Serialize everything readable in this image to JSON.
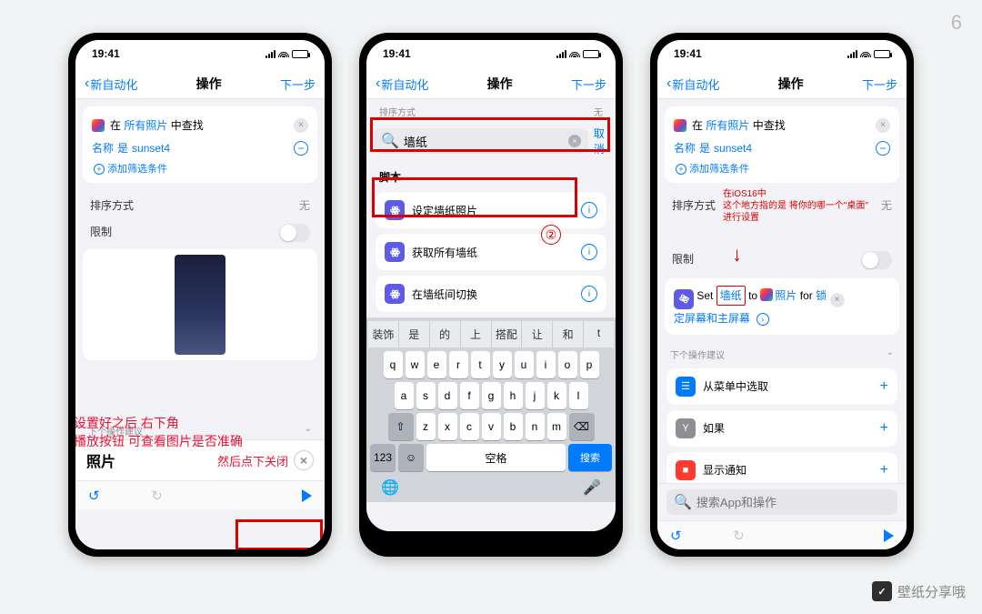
{
  "page_number": "6",
  "statusbar": {
    "time": "19:41"
  },
  "nav": {
    "back": "新自动化",
    "title": "操作",
    "next": "下一步"
  },
  "p1": {
    "find_prefix": "在",
    "find_scope": "所有照片",
    "find_suffix": "中查找",
    "name_label": "名称",
    "is_label": "是",
    "name_value": "sunset4",
    "add_filter": "添加筛选条件",
    "sort_label": "排序方式",
    "sort_value": "无",
    "limit_label": "限制",
    "suggest_label": "下个操作建议",
    "photos_label": "照片",
    "anno1": "设置好之后 右下角\n播放按钮 可查看图片是否准确",
    "anno2": "然后点下关闭"
  },
  "p2": {
    "sort_label": "排序方式",
    "sort_value": "无",
    "search_value": "墙纸",
    "cancel": "取消",
    "section": "脚本",
    "item1": "设定墙纸照片",
    "item2": "获取所有墙纸",
    "item3": "在墙纸间切换",
    "pred": [
      "装饰",
      "是",
      "的",
      "上",
      "搭配",
      "让",
      "和",
      "t"
    ],
    "keys_r1": [
      "q",
      "w",
      "e",
      "r",
      "t",
      "y",
      "u",
      "i",
      "o",
      "p"
    ],
    "keys_r2": [
      "a",
      "s",
      "d",
      "f",
      "g",
      "h",
      "j",
      "k",
      "l"
    ],
    "keys_r3": [
      "z",
      "x",
      "c",
      "v",
      "b",
      "n",
      "m"
    ],
    "k123": "123",
    "space": "空格",
    "search": "搜索"
  },
  "p3": {
    "find_prefix": "在",
    "find_scope": "所有照片",
    "find_suffix": "中查找",
    "name_label": "名称",
    "is_label": "是",
    "name_value": "sunset4",
    "add_filter": "添加筛选条件",
    "sort_label": "排序方式",
    "sort_value": "无",
    "limit_label": "限制",
    "anno_top": "在iOS16中\n这个地方指的是 将你的哪一个\"桌面\"\n进行设置",
    "act_set": "Set",
    "act_token": "墙纸",
    "act_to": "to",
    "act_photo": "照片",
    "act_for": "for",
    "act_lock": "锁",
    "act_line2": "定屏幕和主屏幕",
    "suggest_label": "下个操作建议",
    "s1": "从菜单中选取",
    "s2": "如果",
    "s3": "显示通知",
    "search_ph": "搜索App和操作"
  },
  "watermark": "壁纸分享哦"
}
